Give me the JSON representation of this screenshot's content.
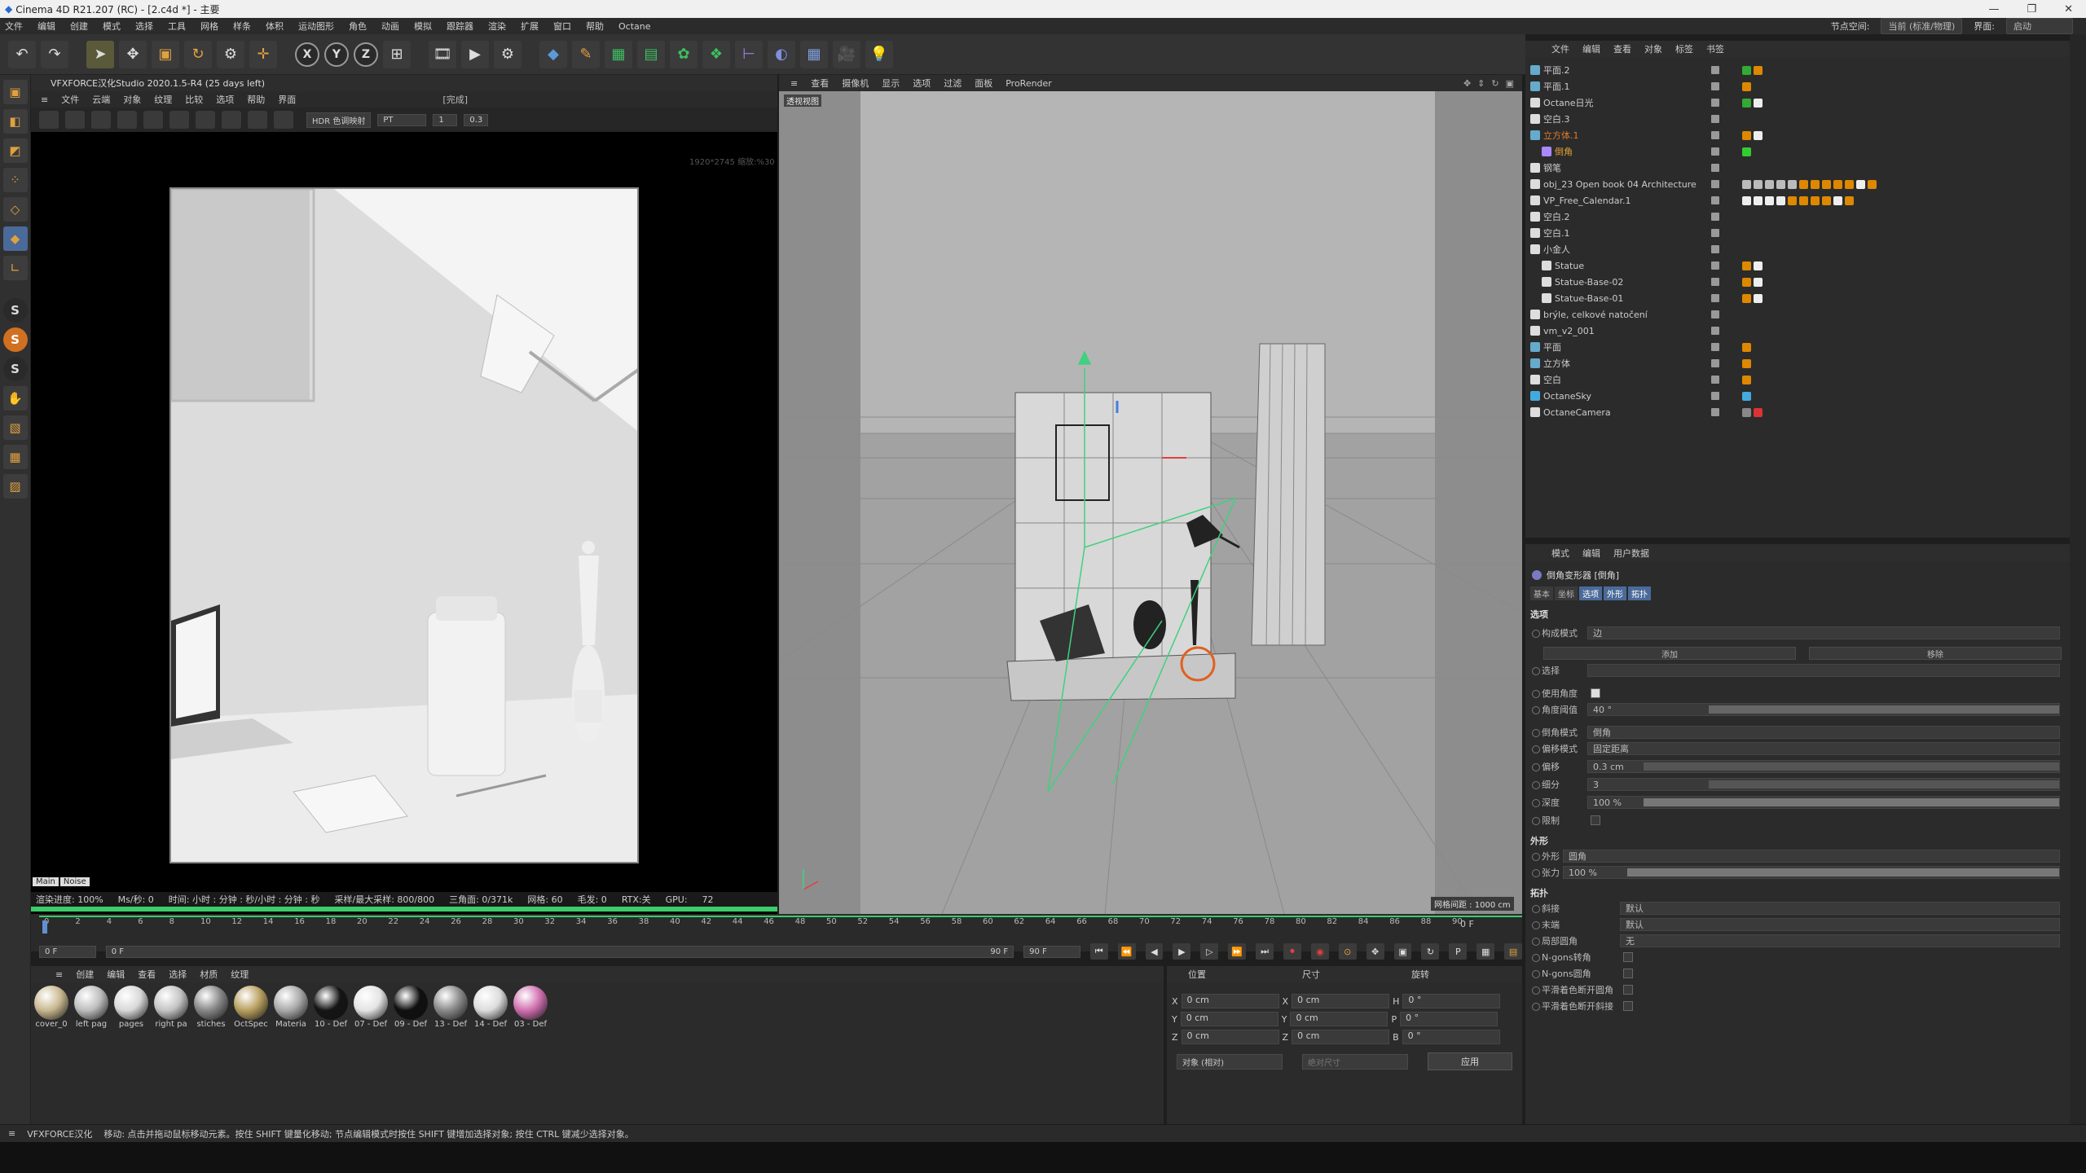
{
  "title": "Cinema 4D R21.207 (RC) - [2.c4d *] - 主要",
  "menu": [
    "文件",
    "编辑",
    "创建",
    "模式",
    "选择",
    "工具",
    "网格",
    "样条",
    "体积",
    "运动图形",
    "角色",
    "动画",
    "模拟",
    "跟踪器",
    "渲染",
    "扩展",
    "窗口",
    "帮助",
    "Octane"
  ],
  "menu_right": {
    "node_space_label": "节点空间:",
    "node_space_value": "当前 (标准/物理)",
    "layout_label": "界面:",
    "layout_value": "启动"
  },
  "octane": {
    "header": "VFXFORCE汉化Studio 2020.1.5-R4 (25 days left)",
    "menu": [
      "文件",
      "云端",
      "对象",
      "纹理",
      "比较",
      "选项",
      "帮助",
      "界面"
    ],
    "done": "[完成]",
    "tone_label": "HDR 色调映射",
    "kernel": "PT",
    "val1": "1",
    "val2": "0.3",
    "res_note": "1920*2745 缩放:%30",
    "tabs": [
      "Main",
      "Noise"
    ],
    "status": [
      "渲染进度: 100%",
      "Ms/秒: 0",
      "时间: 小时 : 分钟 : 秒/小时 : 分钟 : 秒",
      "采样/最大采样: 800/800",
      "三角面: 0/371k",
      "网格: 60",
      "毛发: 0",
      "RTX:关",
      "GPU:",
      "72"
    ],
    "progress": 1.0
  },
  "viewport": {
    "menu": [
      "查看",
      "摄像机",
      "显示",
      "选项",
      "过滤",
      "面板",
      "ProRender"
    ],
    "label": "透视视图",
    "grid": "网格间距 : 1000 cm"
  },
  "timeline": {
    "ticks": [
      "0",
      "2",
      "4",
      "6",
      "8",
      "10",
      "12",
      "14",
      "16",
      "18",
      "20",
      "22",
      "24",
      "26",
      "28",
      "30",
      "32",
      "34",
      "36",
      "38",
      "40",
      "42",
      "44",
      "46",
      "48",
      "50",
      "52",
      "54",
      "56",
      "58",
      "60",
      "62",
      "64",
      "66",
      "68",
      "70",
      "72",
      "74",
      "76",
      "78",
      "80",
      "82",
      "84",
      "86",
      "88",
      "90"
    ],
    "end_label": "0 F",
    "start": "0 F",
    "current": "0 F",
    "max": "90 F",
    "max2": "90 F"
  },
  "materials": {
    "menu": [
      "创建",
      "编辑",
      "查看",
      "选择",
      "材质",
      "纹理"
    ],
    "items": [
      {
        "name": "cover_0",
        "color": "#c9b890"
      },
      {
        "name": "left pag",
        "color": "#bdbdbd"
      },
      {
        "name": "pages",
        "color": "#d8d8d8"
      },
      {
        "name": "right pa",
        "color": "#c4c4c4"
      },
      {
        "name": "stiches",
        "color": "#888888"
      },
      {
        "name": "OctSpec",
        "color": "#b9a060"
      },
      {
        "name": "Materia",
        "color": "#a9a9a9"
      },
      {
        "name": "10 - Def",
        "color": "#151515"
      },
      {
        "name": "07 - Def",
        "color": "#e4e4e4"
      },
      {
        "name": "09 - Def",
        "color": "#101010"
      },
      {
        "name": "13 - Def",
        "color": "#8a8a8a"
      },
      {
        "name": "14 - Def",
        "color": "#dcdcdc"
      },
      {
        "name": "03 - Def",
        "color": "#d070b0"
      }
    ]
  },
  "coords": {
    "headers": [
      "位置",
      "尺寸",
      "旋转"
    ],
    "rows": [
      {
        "a": "X",
        "v1": "0 cm",
        "b": "X",
        "v2": "0 cm",
        "c": "H",
        "v3": "0 °"
      },
      {
        "a": "Y",
        "v1": "0 cm",
        "b": "Y",
        "v2": "0 cm",
        "c": "P",
        "v3": "0 °"
      },
      {
        "a": "Z",
        "v1": "0 cm",
        "b": "Z",
        "v2": "0 cm",
        "c": "B",
        "v3": "0 °"
      }
    ],
    "mode": "对象 (相对)",
    "size_mode": "绝对尺寸",
    "apply": "应用"
  },
  "status_bar": {
    "brand": "VFXFORCE汉化",
    "text": "移动: 点击并拖动鼠标移动元素。按住 SHIFT 键量化移动; 节点编辑模式时按住 SHIFT 键增加选择对象; 按住 CTRL 键减少选择对象。"
  },
  "object_manager": {
    "menu": [
      "文件",
      "编辑",
      "查看",
      "对象",
      "标签",
      "书签"
    ],
    "rows": [
      {
        "name": "平面.2",
        "cls": ""
      },
      {
        "name": "平面.1",
        "cls": ""
      },
      {
        "name": "Octane日光",
        "cls": ""
      },
      {
        "name": "空白.3",
        "cls": ""
      },
      {
        "name": "立方体.1",
        "cls": "sel"
      },
      {
        "name": "倒角",
        "cls": "sel2"
      },
      {
        "name": "钢笔",
        "cls": ""
      },
      {
        "name": "obj_23 Open book 04 Architecture",
        "cls": ""
      },
      {
        "name": "VP_Free_Calendar.1",
        "cls": ""
      },
      {
        "name": "空白.2",
        "cls": ""
      },
      {
        "name": "空白.1",
        "cls": ""
      },
      {
        "name": "小金人",
        "cls": ""
      },
      {
        "name": "Statue",
        "cls": ""
      },
      {
        "name": "Statue-Base-02",
        "cls": ""
      },
      {
        "name": "Statue-Base-01",
        "cls": ""
      },
      {
        "name": "brýle, celkové natočení",
        "cls": ""
      },
      {
        "name": "vm_v2_001",
        "cls": ""
      },
      {
        "name": "平面",
        "cls": ""
      },
      {
        "name": "立方体",
        "cls": ""
      },
      {
        "name": "空白",
        "cls": ""
      },
      {
        "name": "OctaneSky",
        "cls": ""
      },
      {
        "name": "OctaneCamera",
        "cls": ""
      }
    ]
  },
  "attributes": {
    "menu": [
      "模式",
      "编辑",
      "用户数据"
    ],
    "title": "倒角变形器 [倒角]",
    "tabs": [
      "基本",
      "坐标",
      "选项",
      "外形",
      "拓扑"
    ],
    "sec_options": "选项",
    "construct_label": "构成模式",
    "construct_value": "边",
    "add": "添加",
    "remove": "移除",
    "select_label": "选择",
    "use_angle_label": "使用角度",
    "angle_label": "角度阈值",
    "angle_value": "40 °",
    "bevel_mode_label": "倒角模式",
    "bevel_mode_value": "倒角",
    "offset_mode_label": "偏移模式",
    "offset_mode_value": "固定距离",
    "offset_label": "偏移",
    "offset_value": "0.3 cm",
    "subdiv_label": "细分",
    "subdiv_value": "3",
    "depth_label": "深度",
    "depth_value": "100 %",
    "limit_label": "限制",
    "sec_shape": "外形",
    "shape_label": "外形",
    "shape_value": "圆角",
    "tension_label": "张力",
    "tension_value": "100 %",
    "sec_topo": "拓扑",
    "miter_label": "斜接",
    "miter_value": "默认",
    "end_label": "末端",
    "end_value": "默认",
    "partial_label": "局部圆角",
    "partial_value": "无",
    "ngons_label": "N-gons转角",
    "ngons2_label": "N-gons圆角",
    "phong1_label": "平滑着色断开圆角",
    "phong2_label": "平滑着色断开斜接"
  }
}
